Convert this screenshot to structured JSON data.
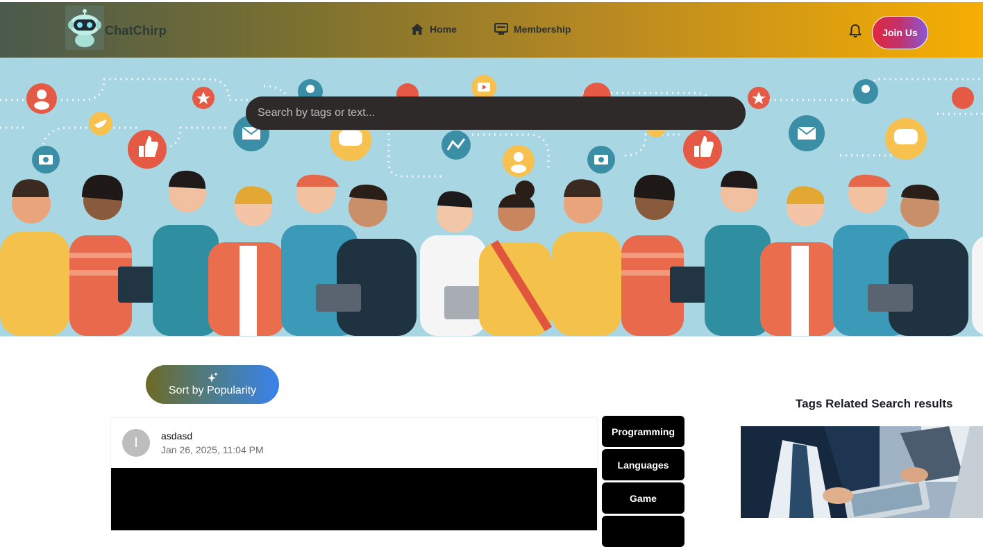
{
  "app": {
    "brand": "ChatChirp",
    "logo_icon": "robot-icon"
  },
  "nav": {
    "home": {
      "label": "Home",
      "icon": "home-icon"
    },
    "membership": {
      "label": "Membership",
      "icon": "membership-icon"
    },
    "notification_icon": "bell-icon",
    "join_label": "Join Us"
  },
  "colors": {
    "navbar_gradient": [
      "#4a5a4c",
      "#7a7030",
      "#b98a22",
      "#f6ae02"
    ],
    "join_gradient": [
      "#e0283d",
      "#8a58d6"
    ],
    "search_bg": "#2e2a2a",
    "hero_bg": "#a9d6e3",
    "tag_bg": "#000000"
  },
  "search": {
    "placeholder": "Search by tags or text..."
  },
  "sort": {
    "label": "Sort by Popularity",
    "icon": "sparkle-icon"
  },
  "post": {
    "avatar_initial": "I",
    "username": "asdasd",
    "date": "Jan 26, 2025, 11:04 PM"
  },
  "tags": [
    "Programming",
    "Languages",
    "Game",
    ""
  ],
  "sidebar": {
    "title": "Tags Related Search results"
  }
}
